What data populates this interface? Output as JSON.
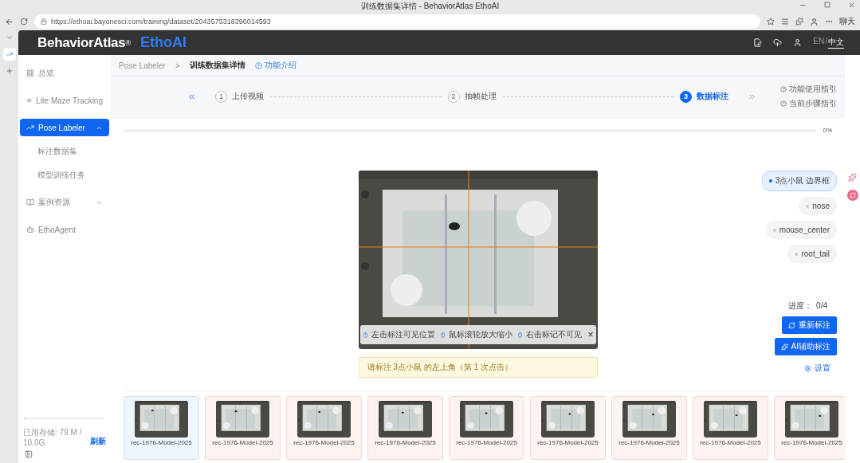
{
  "browser": {
    "tab_title": "训练数据集详情 - BehaviorAtlas EthoAI",
    "url": "https://ethoai.bayonesci.com/training/dataset/2043575318396014593",
    "chat_label": "聊天"
  },
  "header": {
    "brand": "BehaviorAtlas",
    "registered": "®",
    "product": "EthoAI",
    "languages": [
      {
        "label": "EN",
        "selected": false
      },
      {
        "label": "中文",
        "selected": true
      }
    ],
    "separator": "/"
  },
  "sidebar": {
    "items": [
      {
        "label": "总览",
        "selected": false
      },
      {
        "label": "Lite Maze Tracking",
        "selected": false
      },
      {
        "label": "Pose Labeler",
        "selected": true,
        "expanded": true,
        "children": [
          {
            "label": "标注数据集"
          },
          {
            "label": "模型训练任务"
          }
        ]
      },
      {
        "label": "案例资源",
        "selected": false,
        "expanded": false
      },
      {
        "label": "EthoAgent",
        "selected": false
      }
    ],
    "storage": {
      "label": "已用存储: 79 M / 10.0G",
      "level": 0.01,
      "refresh": "刷新"
    }
  },
  "breadcrumb": {
    "items": [
      "Pose Labeler",
      "训练数据集详情"
    ],
    "separator": ">",
    "help": "功能介绍"
  },
  "steps": [
    {
      "number": "1",
      "label": "上传视频",
      "selected": false
    },
    {
      "number": "2",
      "label": "抽帧处理",
      "selected": false
    },
    {
      "number": "3",
      "label": "数据标注",
      "selected": true
    }
  ],
  "guides": [
    "功能使用指引",
    "当前步骤指引"
  ],
  "progress": {
    "level": 0,
    "reading": "0%"
  },
  "hints": [
    "左击标注可见位置",
    "鼠标滚轮放大缩小",
    "右击标记不可见"
  ],
  "hint_close": "×",
  "prompt": "请标注 3点小鼠 的左上角（第 1 次点击）",
  "keypoints": [
    {
      "label": "3点小鼠 边界框",
      "selected": true
    },
    {
      "label": "nose",
      "selected": false
    },
    {
      "label": "mouse_center",
      "selected": false
    },
    {
      "label": "root_tail",
      "selected": false
    }
  ],
  "annotation_progress": "进度：  0/4",
  "actions": [
    {
      "label": "重新标注",
      "kind": "primary"
    },
    {
      "label": "AI辅助标注",
      "kind": "primary"
    },
    {
      "label": "设置",
      "kind": "link"
    }
  ],
  "frames": [
    {
      "label": "rec-1976-Model-2025",
      "selected": true
    },
    {
      "label": "rec-1976-Model-2025",
      "selected": false
    },
    {
      "label": "rec-1976-Model-2025",
      "selected": false
    },
    {
      "label": "rec-1976-Model-2025",
      "selected": false
    },
    {
      "label": "rec-1976-Model-2025",
      "selected": false
    },
    {
      "label": "rec-1976-Model-2025",
      "selected": false
    },
    {
      "label": "rec-1976-Model-2025",
      "selected": false
    },
    {
      "label": "rec-1976-Model-2025",
      "selected": false
    },
    {
      "label": "rec-1976-Model-2025",
      "selected": false
    }
  ]
}
